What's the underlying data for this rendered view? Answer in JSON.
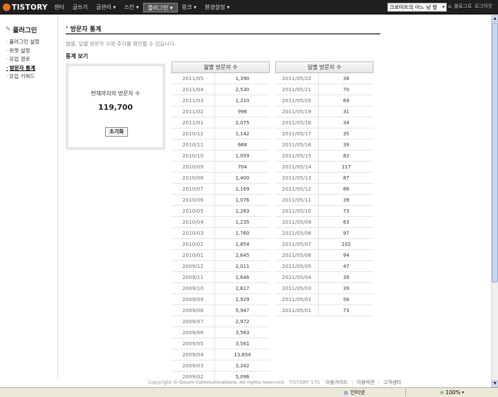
{
  "topnav": {
    "logo": "TISTORY",
    "menu": [
      {
        "label": "센터"
      },
      {
        "label": "글쓰기"
      },
      {
        "label": "글관리 ▾"
      },
      {
        "label": "스킨 ▾"
      },
      {
        "label": "플러그인 ▾",
        "active": true
      },
      {
        "label": "링크 ▾"
      },
      {
        "label": "환경설정 ▾"
      }
    ],
    "blog_select": "크로미트의 어느 낭 말",
    "links": {
      "blog": "블로그로",
      "logout": "로그아웃"
    }
  },
  "sidebar": {
    "title": "플러그인",
    "items": [
      {
        "label": "플러그인 설정"
      },
      {
        "label": "위젯 설정"
      },
      {
        "label": "유입 경로"
      },
      {
        "label": "방문자 통계",
        "active": true
      },
      {
        "label": "유입 키워드"
      }
    ]
  },
  "main": {
    "title": "방문자 통계",
    "description": "월별, 일별 방문자 수와 추이를 확인할 수 있습니다.",
    "section": "통계 보기",
    "total": {
      "label": "현재까지의 방문자 수",
      "value": "119,700",
      "reset_label": "초기화"
    },
    "monthly": {
      "header": "월별 방문자 수",
      "rows": [
        [
          "2011/05",
          "1,390"
        ],
        [
          "2011/04",
          "2,530"
        ],
        [
          "2011/03",
          "1,210"
        ],
        [
          "2011/02",
          "996"
        ],
        [
          "2011/01",
          "2,075"
        ],
        [
          "2010/12",
          "1,142"
        ],
        [
          "2010/11",
          "668"
        ],
        [
          "2010/10",
          "1,059"
        ],
        [
          "2010/09",
          "704"
        ],
        [
          "2010/08",
          "1,400"
        ],
        [
          "2010/07",
          "1,169"
        ],
        [
          "2010/06",
          "1,076"
        ],
        [
          "2010/05",
          "1,283"
        ],
        [
          "2010/04",
          "1,235"
        ],
        [
          "2010/03",
          "1,760"
        ],
        [
          "2010/02",
          "1,854"
        ],
        [
          "2010/01",
          "2,645"
        ],
        [
          "2009/12",
          "2,011"
        ],
        [
          "2009/11",
          "1,646"
        ],
        [
          "2009/10",
          "2,617"
        ],
        [
          "2009/09",
          "2,929"
        ],
        [
          "2009/08",
          "5,947"
        ],
        [
          "2009/07",
          "2,972"
        ],
        [
          "2009/06",
          "3,563"
        ],
        [
          "2009/05",
          "3,561"
        ],
        [
          "2009/04",
          "13,654"
        ],
        [
          "2009/03",
          "3,242"
        ],
        [
          "2009/02",
          "5,096"
        ]
      ]
    },
    "daily": {
      "header": "일별 방문자 수",
      "rows": [
        [
          "2011/05/22",
          "38"
        ],
        [
          "2011/05/21",
          "70"
        ],
        [
          "2011/05/20",
          "69"
        ],
        [
          "2011/05/19",
          "31"
        ],
        [
          "2011/05/18",
          "34"
        ],
        [
          "2011/05/17",
          "35"
        ],
        [
          "2011/05/16",
          "39"
        ],
        [
          "2011/05/15",
          "82"
        ],
        [
          "2011/05/14",
          "117"
        ],
        [
          "2011/05/13",
          "87"
        ],
        [
          "2011/05/12",
          "66"
        ],
        [
          "2011/05/11",
          "39"
        ],
        [
          "2011/05/10",
          "73"
        ],
        [
          "2011/05/09",
          "63"
        ],
        [
          "2011/05/08",
          "97"
        ],
        [
          "2011/05/07",
          "102"
        ],
        [
          "2011/05/06",
          "94"
        ],
        [
          "2011/05/05",
          "47"
        ],
        [
          "2011/05/04",
          "39"
        ],
        [
          "2011/05/03",
          "39"
        ],
        [
          "2011/05/02",
          "56"
        ],
        [
          "2011/05/01",
          "73"
        ]
      ]
    }
  },
  "footer": {
    "copyright": "Copyright © Daum Communications. All rights reserved.",
    "version": "TISTORY 170",
    "links": [
      "이용가이드",
      "이용약관",
      "고객센터"
    ]
  },
  "statusbar": {
    "zone": "인터넷",
    "zoom": "100%"
  }
}
